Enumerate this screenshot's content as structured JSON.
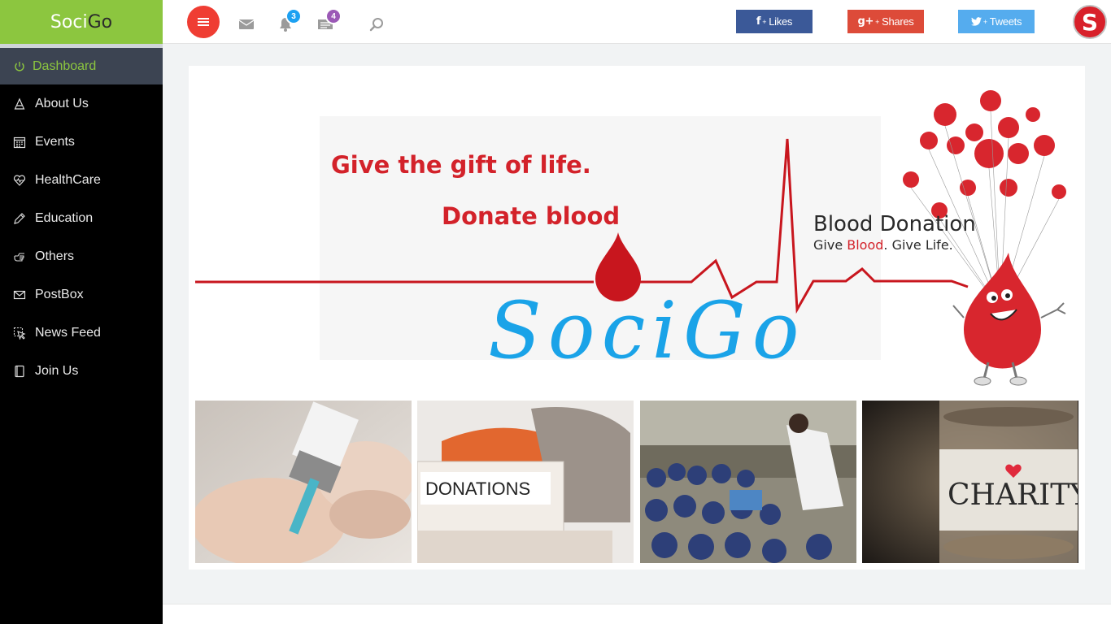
{
  "brand": {
    "part1": "Soci",
    "part2": "Go"
  },
  "sidebar": {
    "items": [
      {
        "label": "Dashboard",
        "icon": "power-icon",
        "active": true
      },
      {
        "label": "About Us",
        "icon": "triangle-icon"
      },
      {
        "label": "Events",
        "icon": "calendar-icon"
      },
      {
        "label": "HealthCare",
        "icon": "heart-pulse-icon"
      },
      {
        "label": "Education",
        "icon": "pencil-icon"
      },
      {
        "label": "Others",
        "icon": "hand-pointer-icon"
      },
      {
        "label": "PostBox",
        "icon": "envelope-icon"
      },
      {
        "label": "News Feed",
        "icon": "cursor-icon"
      },
      {
        "label": "Join Us",
        "icon": "book-icon"
      }
    ]
  },
  "topbar": {
    "notifications_badge": "3",
    "messages_badge": "4",
    "social": {
      "facebook": {
        "icon": "f",
        "plus": "+",
        "label": "Likes",
        "color": "#3b5998"
      },
      "google": {
        "icon": "g+",
        "plus": "+",
        "label": "Shares",
        "color": "#dd4b39"
      },
      "twitter": {
        "plus": "+",
        "label": "Tweets",
        "color": "#55acee"
      }
    },
    "avatar_letter": "S"
  },
  "hero": {
    "line1": "Give the gift of life.",
    "line2": "Donate blood",
    "blood_donation": "Blood Donation",
    "tagline_a": "Give ",
    "tagline_red": "Blood",
    "tagline_b": ". Give Life.",
    "logo_text": "SociGo"
  },
  "thumbnails": [
    {
      "name": "vaccine-photo"
    },
    {
      "name": "donations-photo",
      "label": "DONATIONS"
    },
    {
      "name": "children-photo"
    },
    {
      "name": "charity-photo",
      "label": "CHARITY"
    }
  ],
  "colors": {
    "accent_green": "#8cc63f",
    "menu_red": "#ef3d33",
    "blood_red": "#d3222a",
    "logo_blue": "#1aa3e8"
  }
}
